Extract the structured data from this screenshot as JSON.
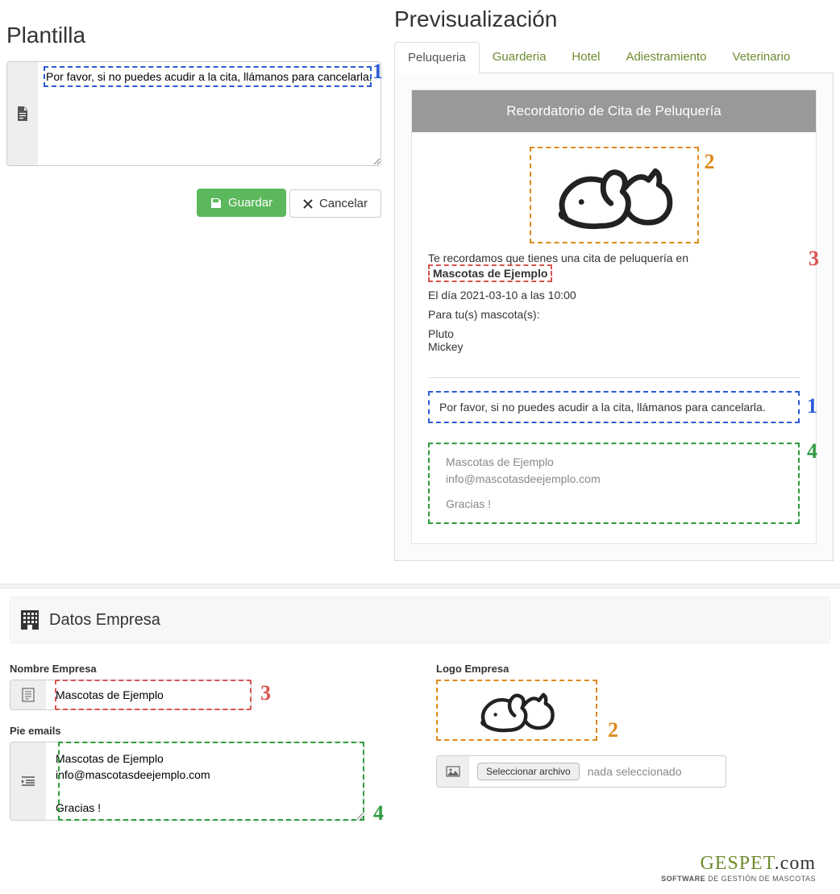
{
  "plantilla": {
    "title": "Plantilla",
    "textarea_value": "Por favor, si no puedes acudir a la cita, llámanos para cancelarla.",
    "save_label": "Guardar",
    "cancel_label": "Cancelar"
  },
  "preview": {
    "title": "Previsualización",
    "tabs": [
      "Peluqueria",
      "Guarderia",
      "Hotel",
      "Adiestramiento",
      "Veterinario"
    ],
    "active_tab_index": 0,
    "email": {
      "header": "Recordatorio de Cita de Peluquería",
      "line1_prefix": "Te recordamos que tienes una cita de peluquería en ",
      "company_name": "Mascotas de Ejemplo",
      "date_line": "El día 2021-03-10 a las 10:00",
      "pets_label": "Para tu(s) mascota(s):",
      "pets": [
        "Pluto",
        "Mickey"
      ],
      "footer_msg": "Por favor, si no puedes acudir a la cita, llámanos para cancelarla.",
      "signature_name": "Mascotas de Ejemplo",
      "signature_email": "info@mascotasdeejemplo.com",
      "signature_thanks": "Gracias !"
    }
  },
  "badges": {
    "b1": "1",
    "b2": "2",
    "b3": "3",
    "b4": "4"
  },
  "company": {
    "section_title": "Datos Empresa",
    "name_label": "Nombre Empresa",
    "name_value": "Mascotas de Ejemplo",
    "footer_label": "Pie emails",
    "footer_value": "Mascotas de Ejemplo\ninfo@mascotasdeejemplo.com\n\nGracias !",
    "logo_label": "Logo Empresa",
    "file_button": "Seleccionar archivo",
    "file_status": "nada seleccionado"
  },
  "brand": {
    "name_part1": "GESPET",
    "name_part2": ".com",
    "tagline_bold": "SOFTWARE",
    "tagline_rest": " DE GESTIÓN DE MASCOTAS"
  }
}
